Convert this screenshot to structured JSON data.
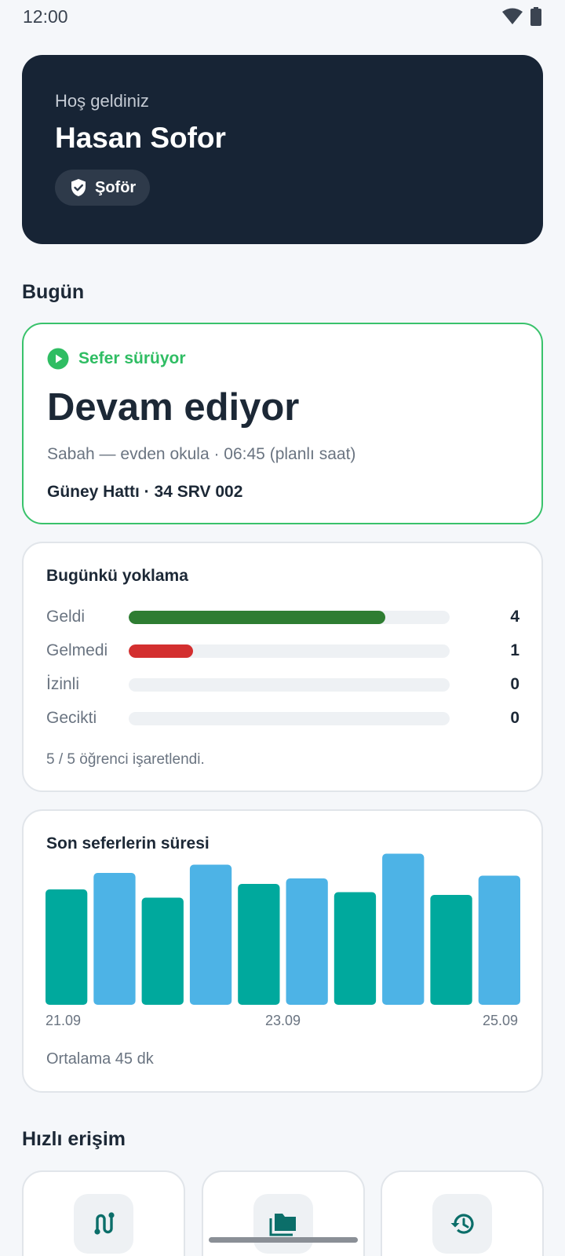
{
  "status": {
    "time": "12:00"
  },
  "hero": {
    "greeting": "Hoş geldiniz",
    "name": "Hasan Sofor",
    "role": "Şoför"
  },
  "today": {
    "section_title": "Bugün",
    "trip": {
      "status_label": "Sefer sürüyor",
      "title": "Devam ediyor",
      "subtitle": "Sabah — evden okula · 06:45 (planlı saat)",
      "route": "Güney Hattı · 34 SRV 002"
    },
    "attendance": {
      "title": "Bugünkü yoklama",
      "rows": [
        {
          "label": "Geldi",
          "count": "4",
          "fraction": 0.8,
          "color": "#2e7d32"
        },
        {
          "label": "Gelmedi",
          "count": "1",
          "fraction": 0.2,
          "color": "#d32f2f"
        },
        {
          "label": "İzinli",
          "count": "0",
          "fraction": 0,
          "color": "#9e9e9e"
        },
        {
          "label": "Gecikti",
          "count": "0",
          "fraction": 0,
          "color": "#f9a825"
        }
      ],
      "note": "5 / 5 öğrenci işaretlendi."
    },
    "durations": {
      "title": "Son seferlerin süresi",
      "average": "Ortalama 45 dk"
    }
  },
  "chart_data": {
    "type": "bar",
    "x_tick_labels": [
      "21.09",
      "23.09",
      "25.09"
    ],
    "values": [
      42,
      48,
      39,
      51,
      44,
      46,
      41,
      55,
      40,
      47
    ],
    "colors": [
      "#00a99d",
      "#4db3e6"
    ],
    "ylim": [
      0,
      60
    ]
  },
  "quick_access": {
    "title": "Hızlı erişim",
    "items": [
      {
        "icon": "route-icon"
      },
      {
        "icon": "folder-icon"
      },
      {
        "icon": "history-icon"
      }
    ]
  },
  "colors": {
    "accent_green": "#2fbd63",
    "hero_bg": "#172435"
  }
}
